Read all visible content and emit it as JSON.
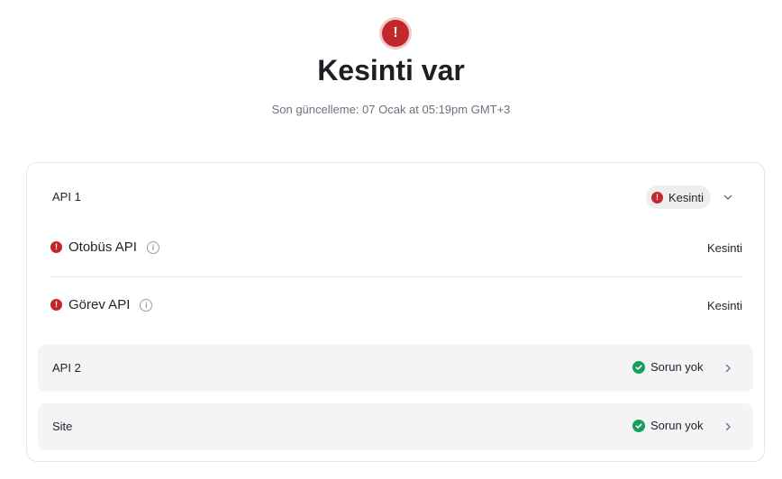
{
  "header": {
    "title": "Kesinti var",
    "subtitle": "Son güncelleme: 07 Ocak at 05:19pm GMT+3",
    "icon": "alert-circle-icon",
    "accent_color": "#c0282c"
  },
  "groups": [
    {
      "name": "API 1",
      "status": "Kesinti",
      "expanded": true,
      "components": [
        {
          "name": "Otobüs API",
          "status": "Kesinti"
        },
        {
          "name": "Görev API",
          "status": "Kesinti"
        }
      ]
    },
    {
      "name": "API 2",
      "status": "Sorun yok",
      "expanded": false
    },
    {
      "name": "Site",
      "status": "Sorun yok",
      "expanded": false
    }
  ],
  "colors": {
    "outage": "#c0282c",
    "operational": "#1a9e5c"
  }
}
